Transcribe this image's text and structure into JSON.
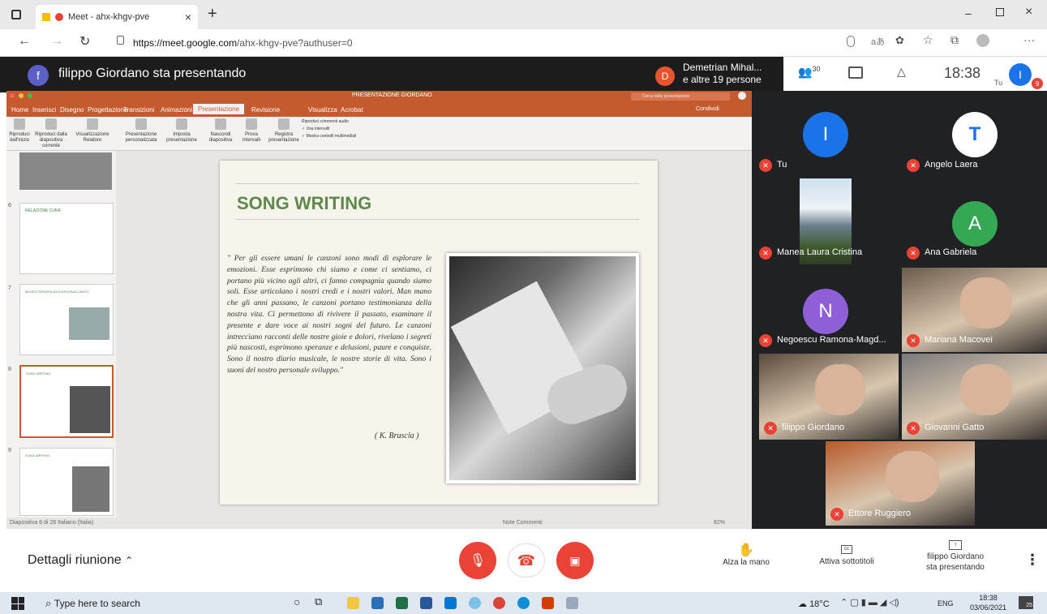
{
  "browser": {
    "tab_title": "Meet - ahx-khgv-pve",
    "url_host": "https://meet.google.com",
    "url_path": "/ahx-khgv-pve?authuser=0"
  },
  "meet": {
    "presenter_initial": "f",
    "presenting_title": "filippo Giordano sta presentando",
    "others_initial": "D",
    "others_name": "Demetrian Mihal...",
    "others_count": "e altre 19 persone",
    "people_count": "30",
    "time": "18:38",
    "self_label": "Tu",
    "self_initial": "I",
    "notification_badge": "9"
  },
  "participants": [
    {
      "name": "Tu",
      "initial": "I",
      "color": "#1a73e8"
    },
    {
      "name": "Angelo Laera",
      "initial": "T",
      "color": "#ffffff"
    },
    {
      "name": "Manea Laura Cristina",
      "initial": "",
      "color": "#5a7a9a"
    },
    {
      "name": "Ana Gabriela",
      "initial": "A",
      "color": "#34a853"
    },
    {
      "name": "Negoescu Ramona-Magd...",
      "initial": "N",
      "color": "#8e5fd6"
    },
    {
      "name": "Mariana Macovei",
      "initial": "",
      "color": "#6b5a4a"
    },
    {
      "name": "filippo Giordano",
      "initial": "",
      "color": "#5a4a3a"
    },
    {
      "name": "Giovanni Gatto",
      "initial": "",
      "color": "#7a7a7a"
    },
    {
      "name": "Ettore Ruggiero",
      "initial": "",
      "color": "#b85a2a"
    }
  ],
  "ppt": {
    "title": "PRESENTAZIONE GIORDANO",
    "search_placeholder": "Cerca nella presentazione",
    "tabs": [
      "Home",
      "Inserisci",
      "Disegno",
      "Progettazione",
      "Transizioni",
      "Animazioni",
      "Presentazione",
      "Revisione",
      "Visualizza",
      "Acrobat"
    ],
    "active_tab": "Presentazione",
    "share": "Condividi",
    "ribbon_buttons": [
      "Riproduci dall'inizio",
      "Riproduci dalla diapositiva corrente",
      "Visualizzazione Relatore",
      "Presentazione personalizzata",
      "Imposta presentazione",
      "Nascondi diapositiva",
      "Prova intervalli",
      "Registra presentazione"
    ],
    "checkboxes": [
      "Riproduci commenti audio",
      "Usa intervalli",
      "Mostra controlli multimediali"
    ],
    "slide_numbers": [
      "6",
      "7",
      "8",
      "9"
    ],
    "thumb_titles": [
      "RELAZIONE CURA",
      "MUSICOTERAPIA ADOLESCENZA CANTO",
      "SONG WRITING",
      "SONG WRITING"
    ],
    "status_left": "Diapositiva 8 di 28   Italiano (Italia)",
    "status_right": "Note   Commenti",
    "zoom": "82%"
  },
  "slide": {
    "title": "SONG WRITING",
    "quote": "\" Per gli essere umani le canzoni sono modi di esplorare le emozioni. Esse esprimono chi siamo e come ci sentiamo, ci portano più vicino agli altri, ci fanno compagnia quando siamo soli. Esse articolano i nostri credi e i nostri valori. Man mano che gli anni passano, le canzoni portano testimonianza della nostra vita. Ci permettono di rivivere il passato, esaminare il presente e dare voce ai nostri sogni del futuro. Le canzoni intrecciano racconti delle nostre gioie e dolori, rivelano i segreti più nascosti, esprimono speranze e delusioni, paure e conquiste. Sono il nostro diario musicale, le nostre storie di vita. Sono i suoni del nostro personale sviluppo.\"",
    "author": "( K. Bruscia )"
  },
  "meetbar": {
    "details": "Dettagli riunione",
    "raise_hand": "Alza la mano",
    "captions": "Attiva sottotitoli",
    "presenting_line1": "filippo Giordano",
    "presenting_line2": "sta presentando"
  },
  "taskbar": {
    "search_placeholder": "Type here to search",
    "temperature": "18°C",
    "lang": "ENG",
    "time": "18:38",
    "date": "03/06/2021",
    "notif": "25"
  }
}
